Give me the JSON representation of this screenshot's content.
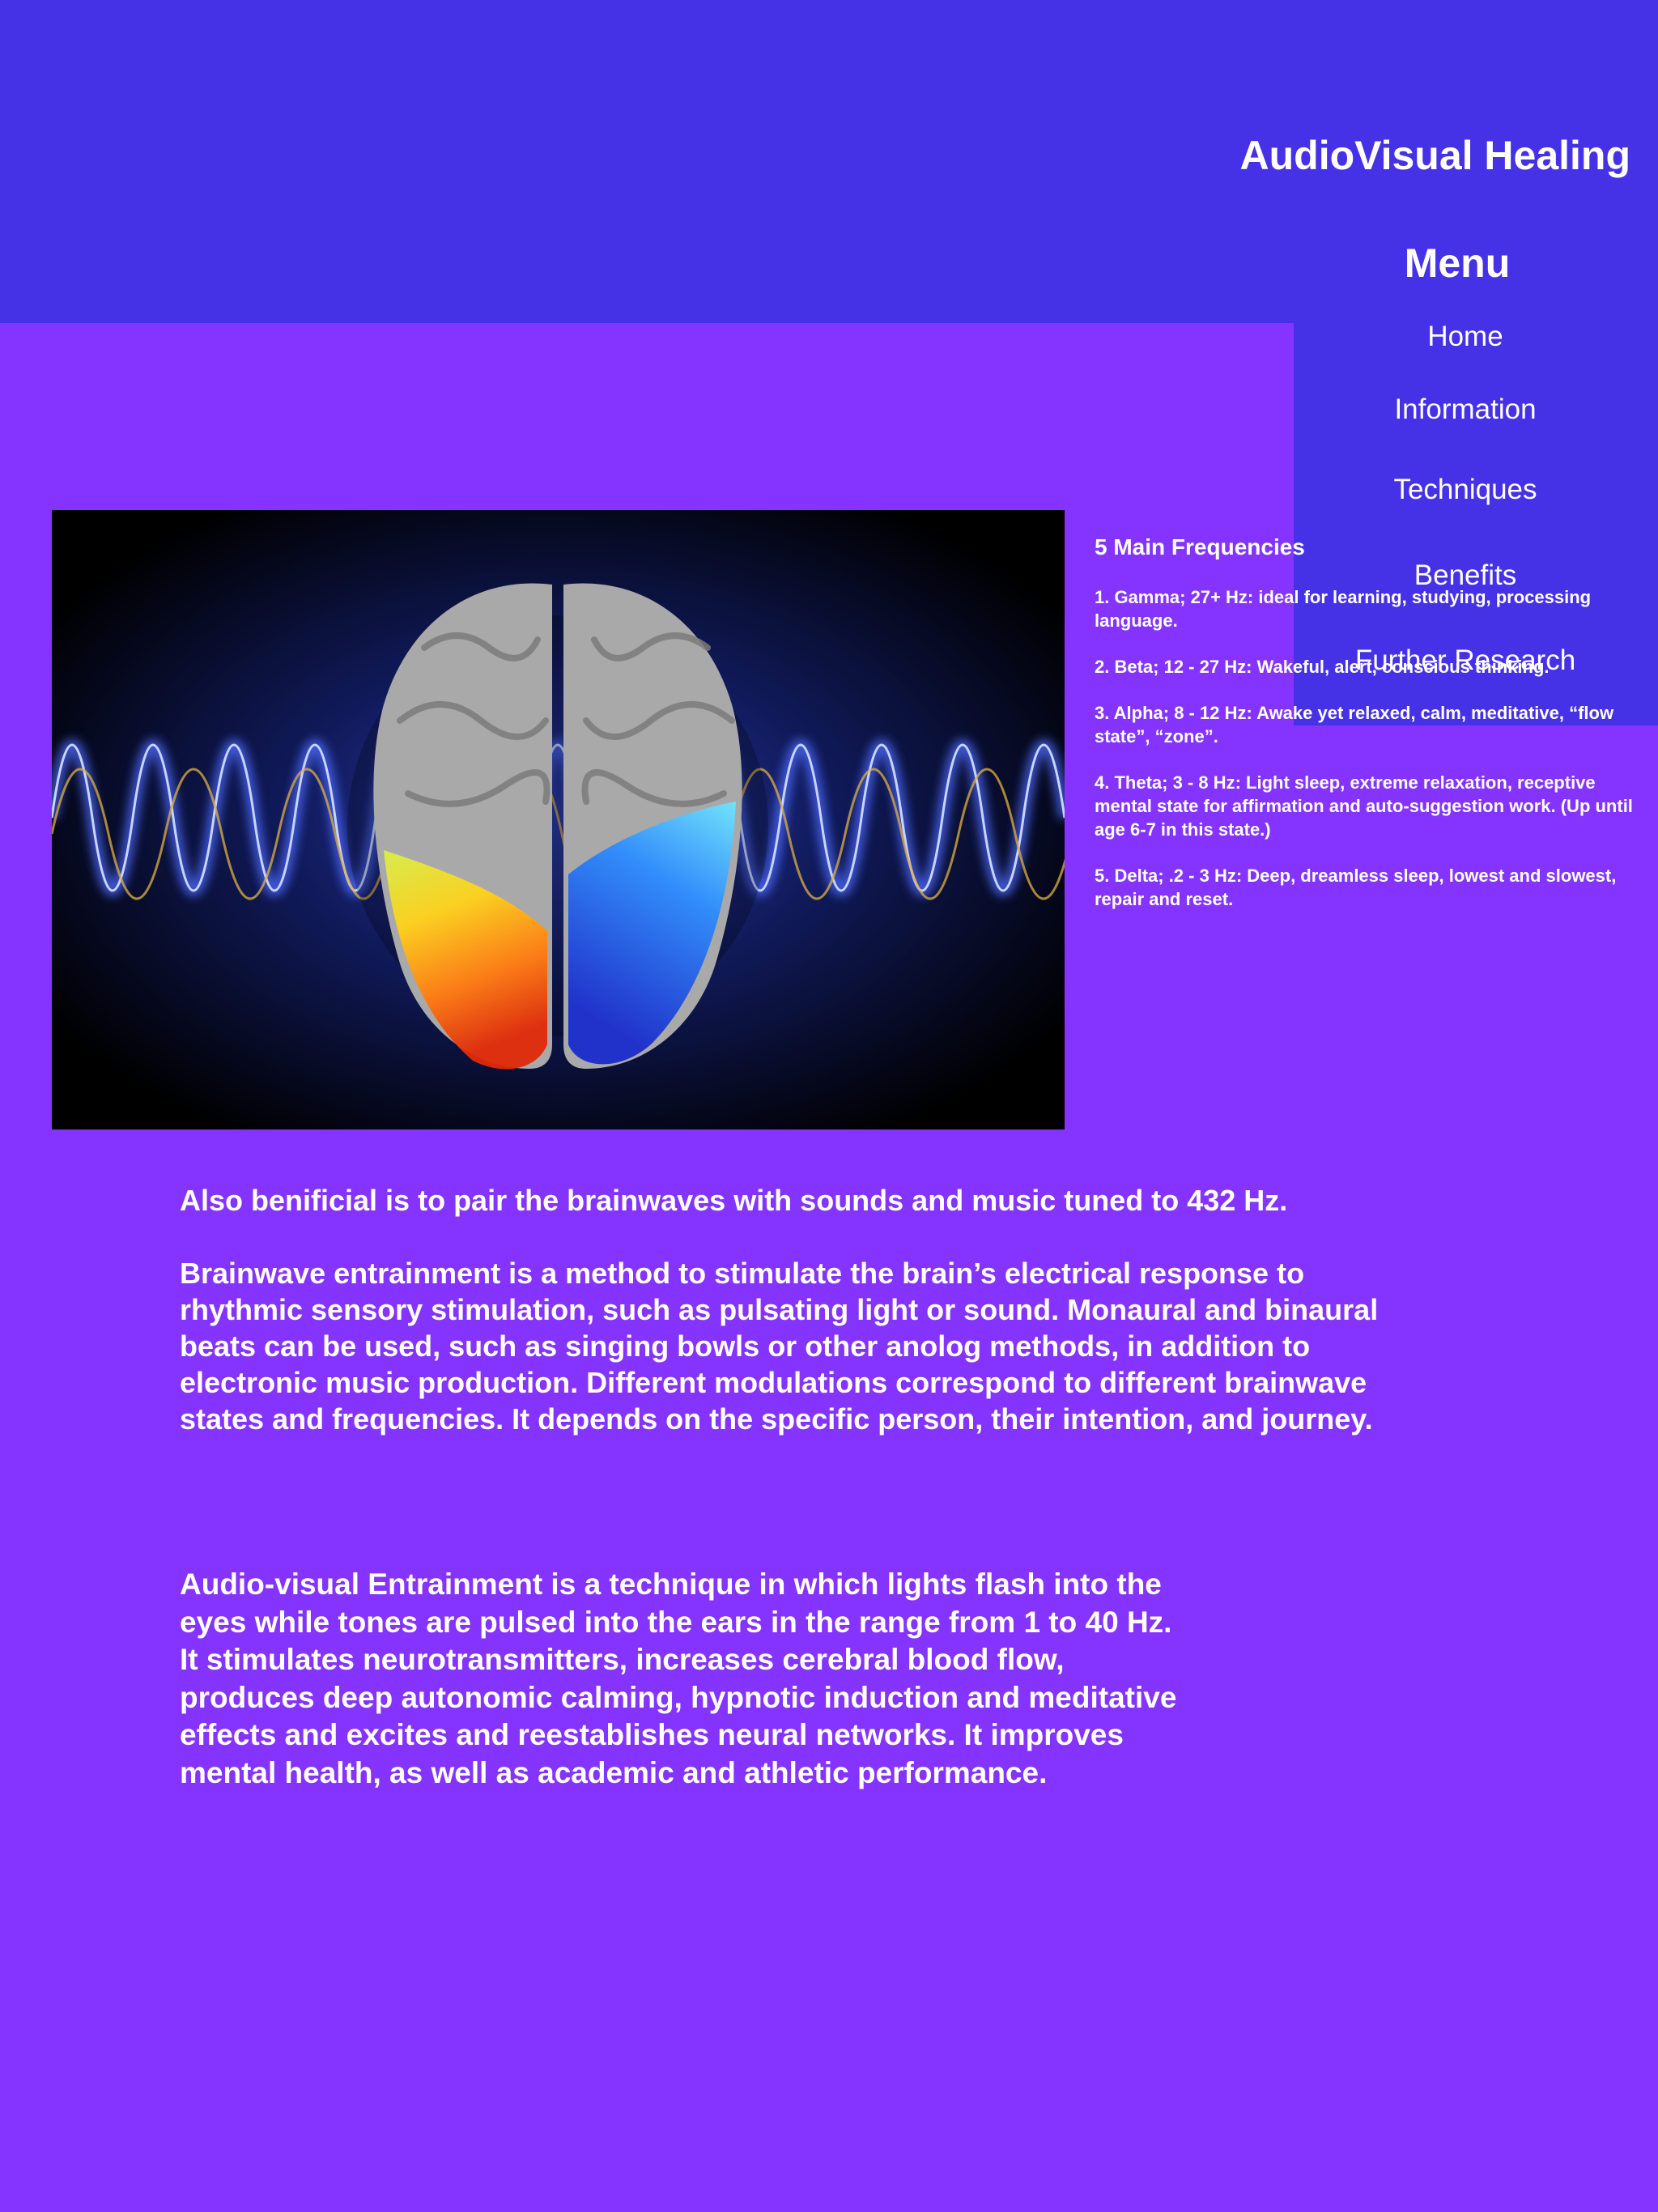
{
  "site": {
    "title": "AudioVisual Healing"
  },
  "menu": {
    "title": "Menu",
    "items": [
      {
        "label": "Home"
      },
      {
        "label": "Information"
      },
      {
        "label": "Techniques"
      },
      {
        "label": "Benefits"
      },
      {
        "label": "Further Research"
      }
    ]
  },
  "frequencies": {
    "heading": "5 Main Frequencies",
    "items": [
      {
        "text": "1. Gamma; 27+ Hz: ideal for learning, studying, processing language."
      },
      {
        "text": "2. Beta; 12 - 27 Hz: Wakeful, alert, conscious thinking."
      },
      {
        "text": "3. Alpha; 8 - 12 Hz: Awake yet relaxed, calm, meditative, “flow state”, “zone”."
      },
      {
        "text": "4. Theta; 3 - 8 Hz: Light sleep, extreme relaxation, receptive mental state for affirmation and auto-suggestion work. (Up until age 6-7 in this state.)"
      },
      {
        "text": "5. Delta; .2 - 3 Hz: Deep, dreamless sleep, lowest and slowest, repair and reset."
      }
    ]
  },
  "content": {
    "tuning": "Also benificial is to pair the brainwaves with sounds and music tuned to 432 Hz.",
    "brainwave_entrainment": "Brainwave entrainment is a method to stimulate the brain’s electrical response to rhythmic sensory stimulation, such as pulsating light or sound. Monaural and binaural beats can be used, such as singing bowls or other anolog methods, in addition to electronic music production. Different modulations correspond to different brainwave states and frequencies. It depends on the specific person, their intention, and journey.",
    "audio_visual_entrainment": "Audio-visual Entrainment is a technique in which lights flash into the eyes while tones are pulsed into the ears in the range from 1 to 40 Hz. It stimulates neurotransmitters, increases cerebral blood flow, produces deep autonomic calming, hypnotic induction and meditative effects and excites and reestablishes neural networks. It improves mental health, as well as academic and athletic performance."
  },
  "colors": {
    "page_background": "#8434FE",
    "header_background": "#4632E6",
    "text": "#FFFFFF"
  }
}
